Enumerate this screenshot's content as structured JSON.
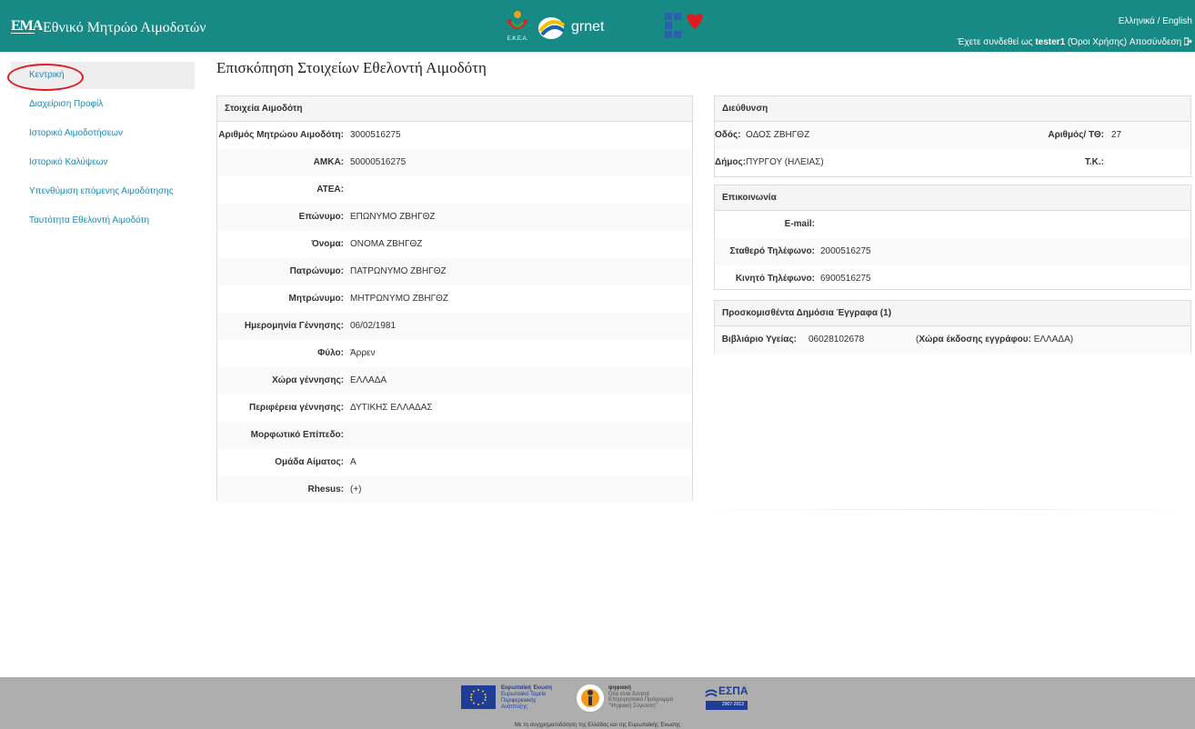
{
  "header": {
    "brand_short": "ΕΜΑ",
    "brand_title": "Εθνικό Μητρώο Αιμοδοτών",
    "grnet_label": "grnet",
    "epsa_label": "E.K.E.A.",
    "lang_greek": "Ελληνικά",
    "lang_sep": " / ",
    "lang_english": "English",
    "logged_prefix": "Έχετε συνδεθεί ως ",
    "username": "tester1",
    "terms": "Όροι Χρήσης",
    "logout": "Αποσύνδεση"
  },
  "sidebar": {
    "items": [
      {
        "label": "Κεντρική"
      },
      {
        "label": "Διαχείριση Προφίλ"
      },
      {
        "label": "Ιστορικό Αιμοδοτήσεων"
      },
      {
        "label": "Ιστορικό Καλύψεων"
      },
      {
        "label": "Υπενθύμιση επόμενης Αιμοδότησης"
      },
      {
        "label": "Ταυτότητα Εθελοντή Αιμοδότη"
      }
    ]
  },
  "page_title": "Επισκόπηση Στοιχείων Εθελοντή Αιμοδότη",
  "donor": {
    "heading": "Στοιχεία Αιμοδότη",
    "rows": [
      {
        "label": "Αριθμός Μητρώου Αιμοδότη:",
        "value": "3000516275"
      },
      {
        "label": "ΑΜΚΑ:",
        "value": "50000516275"
      },
      {
        "label": "ΑΤΕΑ:",
        "value": ""
      },
      {
        "label": "Επώνυμο:",
        "value": "ΕΠΩΝΥΜΟ ΖΒΗΓΘΖ"
      },
      {
        "label": "Όνομα:",
        "value": "ΟΝΟΜΑ ΖΒΗΓΘΖ"
      },
      {
        "label": "Πατρώνυμο:",
        "value": "ΠΑΤΡΩΝΥΜΟ ΖΒΗΓΘΖ"
      },
      {
        "label": "Μητρώνυμο:",
        "value": "ΜΗΤΡΩΝΥΜΟ ΖΒΗΓΘΖ"
      },
      {
        "label": "Ημερομηνία Γέννησης:",
        "value": "06/02/1981"
      },
      {
        "label": "Φύλο:",
        "value": "Άρρεν"
      },
      {
        "label": "Χώρα γέννησης:",
        "value": "ΕΛΛΑΔΑ"
      },
      {
        "label": "Περιφέρεια γέννησης:",
        "value": "ΔΥΤΙΚΗΣ ΕΛΛΑΔΑΣ"
      },
      {
        "label": "Μορφωτικό Επίπεδο:",
        "value": ""
      },
      {
        "label": "Ομάδα Αίματος:",
        "value": "Α"
      },
      {
        "label": "Rhesus:",
        "value": "(+)"
      }
    ]
  },
  "address": {
    "heading": "Διεύθυνση",
    "street_label": "Οδός:",
    "street_value": "ΟΔΟΣ ΖΒΗΓΘΖ",
    "number_label": "Αριθμός/ ΤΘ:",
    "number_value": "27",
    "municipality_label": "Δήμος:",
    "municipality_value": "ΠΥΡΓΟΥ (ΗΛΕΙΑΣ)",
    "postal_label": "Τ.Κ.:",
    "postal_value": ""
  },
  "contact": {
    "heading": "Επικοινωνία",
    "email_label": "E-mail:",
    "email_value": "",
    "phone_label": "Σταθερό Τηλέφωνο:",
    "phone_value": "2000516275",
    "mobile_label": "Κινητό Τηλέφωνο:",
    "mobile_value": "6900516275"
  },
  "documents": {
    "heading": "Προσκομισθέντα Δημόσια Έγγραφα (1)",
    "doc_label": "Βιβλιάριο Υγείας:",
    "doc_value": "06028102678",
    "country_prefix": "(",
    "country_label": "Χώρα έκδοσης εγγράφου:",
    "country_value": " ΕΛΛΑΔΑ)"
  },
  "footer": {
    "eu_text": "Ευρωπαϊκή Ένωση",
    "eu_sub1": "Ευρωπαϊκό Ταμείο",
    "eu_sub2": "Περιφερειακής",
    "eu_sub3": "Ανάπτυξης",
    "dig_text1": "ψηφιακή",
    "dig_text2": "Όλα είναι δυνατά",
    "dig_text3": "Επιχειρησιακό Πρόγραμμα",
    "dig_text4": "\"Ψηφιακή Σύγκλιση\"",
    "espa": "ΕΣΠΑ",
    "espa_years": "2007-2013",
    "caption": "Με τη συγχρηματοδότηση της Ελλάδας και της Ευρωπαϊκής Ένωσης"
  },
  "colors": {
    "header_bg": "#178a86",
    "link": "#1a8ab8",
    "highlight": "#e21b23",
    "footer_bg": "#aeaeae"
  }
}
